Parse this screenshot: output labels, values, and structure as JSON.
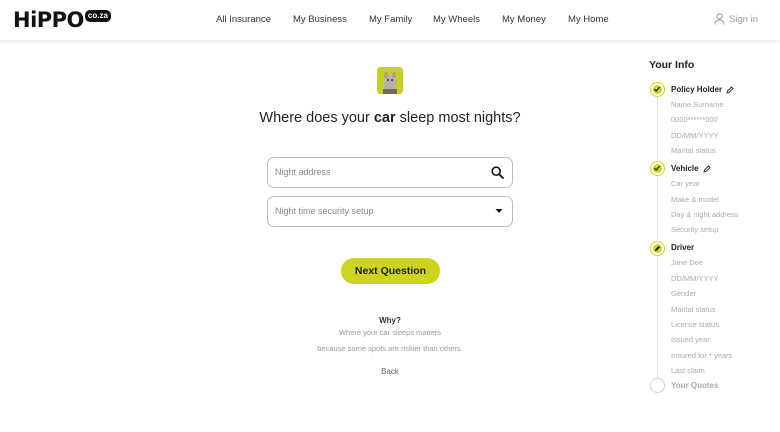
{
  "header": {
    "logo_text": "HiPPO",
    "logo_badge": "co.za",
    "nav": [
      "All Insurance",
      "My Business",
      "My Family",
      "My Wheels",
      "My Money",
      "My Home"
    ],
    "signin": "Sign in"
  },
  "main": {
    "question_pre": "Where does your",
    "question_bold": "car",
    "question_post": "sleep most nights?",
    "address_placeholder": "Night address",
    "security_placeholder": "Night time security setup",
    "next_button": "Next Question",
    "why_title": "Why?",
    "why_line1": "Where your car sleeps matters",
    "why_line2": "because some spots are riskier than others.",
    "back": "Back"
  },
  "sidebar": {
    "title": "Your Info",
    "policy_holder": {
      "label": "Policy Holder",
      "items": [
        "Name Surname",
        "0000******000",
        "DD/MM/YYYY",
        "Marital status"
      ]
    },
    "vehicle": {
      "label": "Vehicle",
      "items": [
        "Car year",
        "Make & model",
        "Day & night address",
        "Security setup"
      ]
    },
    "driver": {
      "label": "Driver",
      "items": [
        "Jane Doe",
        "DD/MM/YYYY",
        "Gender",
        "Marital status",
        "License status",
        "Issued year",
        "Insured for * years",
        "Last claim"
      ]
    },
    "quotes": "Your Quotes"
  },
  "colors": {
    "accent": "#cdd41f",
    "text": "#1f1f1f",
    "muted": "#aaaaaa"
  }
}
